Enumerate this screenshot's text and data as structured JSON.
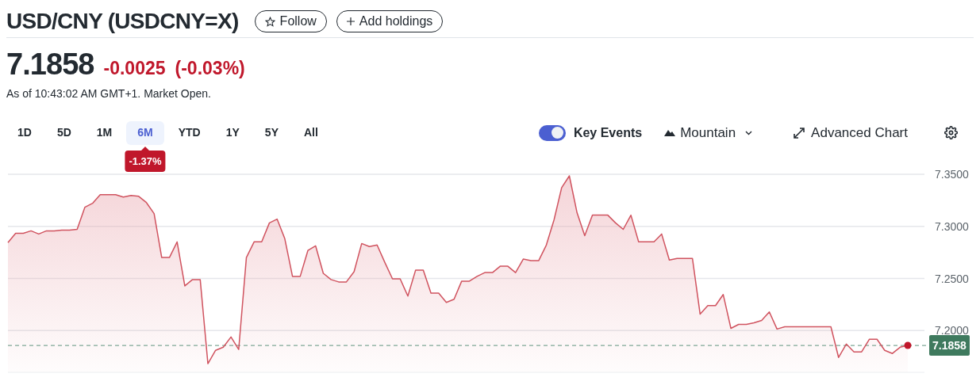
{
  "header": {
    "title": "USD/CNY (USDCNY=X)",
    "buttons": [
      {
        "kind": "follow",
        "label": "Follow"
      },
      {
        "kind": "add",
        "label": "Add holdings"
      }
    ]
  },
  "quote": {
    "price": "7.1858",
    "change": "-0.0025",
    "change_percent": "(-0.03%)",
    "timestamp": "As of 10:43:02 AM GMT+1. Market Open."
  },
  "range_tabs": [
    {
      "label": "1D",
      "selected": false
    },
    {
      "label": "5D",
      "selected": false
    },
    {
      "label": "1M",
      "selected": false
    },
    {
      "label": "6M",
      "selected": true
    },
    {
      "label": "YTD",
      "selected": false
    },
    {
      "label": "1Y",
      "selected": false
    },
    {
      "label": "5Y",
      "selected": false
    },
    {
      "label": "All",
      "selected": false
    }
  ],
  "range_change_badge": "-1.37%",
  "toolbar": {
    "key_events": {
      "label": "Key Events",
      "on": true
    },
    "chart_type": "Mountain",
    "advanced_chart": "Advanced Chart"
  },
  "chart": {
    "chart_data": {
      "type": "area",
      "grid": true,
      "ylim": [
        7.16,
        7.35
      ],
      "yticks": [
        {
          "value": 7.2,
          "label": "7.2000"
        },
        {
          "value": 7.25,
          "label": "7.2500"
        },
        {
          "value": 7.3,
          "label": "7.3000"
        },
        {
          "value": 7.35,
          "label": "7.3500"
        }
      ],
      "series": [
        {
          "color": "#d0535f",
          "values": [
            7.2844,
            7.2934,
            7.2934,
            7.2957,
            7.2927,
            7.2957,
            7.2957,
            7.2965,
            7.2965,
            7.2972,
            7.3183,
            7.3221,
            7.3304,
            7.3304,
            7.3304,
            7.3281,
            7.3296,
            7.3289,
            7.3229,
            7.3123,
            7.2701,
            7.2701,
            7.2852,
            7.2429,
            7.249,
            7.249,
            7.1683,
            7.1811,
            7.1841,
            7.1939,
            7.1819,
            7.2701,
            7.2852,
            7.2852,
            7.3033,
            7.307,
            7.2882,
            7.252,
            7.252,
            7.2769,
            7.2814,
            7.255,
            7.249,
            7.2467,
            7.2467,
            7.2565,
            7.2836,
            7.2806,
            7.2821,
            7.2656,
            7.2497,
            7.2497,
            7.2331,
            7.258,
            7.258,
            7.2361,
            7.2361,
            7.2271,
            7.2301,
            7.2475,
            7.2475,
            7.252,
            7.2557,
            7.2557,
            7.2618,
            7.2618,
            7.2557,
            7.2686,
            7.2671,
            7.2671,
            7.2821,
            7.3063,
            7.3372,
            7.3485,
            7.3131,
            7.2912,
            7.3108,
            7.3108,
            7.3108,
            7.3033,
            7.2972,
            7.3108,
            7.2852,
            7.2852,
            7.2852,
            7.2927,
            7.2678,
            7.2693,
            7.2693,
            7.2693,
            7.2158,
            7.2241,
            7.2241,
            7.2346,
            7.2022,
            7.206,
            7.206,
            7.2075,
            7.2098,
            7.218,
            7.2015,
            7.2037,
            7.2037,
            7.2037,
            7.2037,
            7.2037,
            7.2037,
            7.2037,
            7.1743,
            7.1871,
            7.1796,
            7.1796,
            7.1917,
            7.1917,
            7.1811,
            7.1781,
            7.1841,
            7.1858
          ]
        }
      ],
      "ref_lines": [
        {
          "axis": "y",
          "value": 7.1858,
          "label": "7.1858",
          "color": "#7fa896"
        }
      ]
    }
  }
}
